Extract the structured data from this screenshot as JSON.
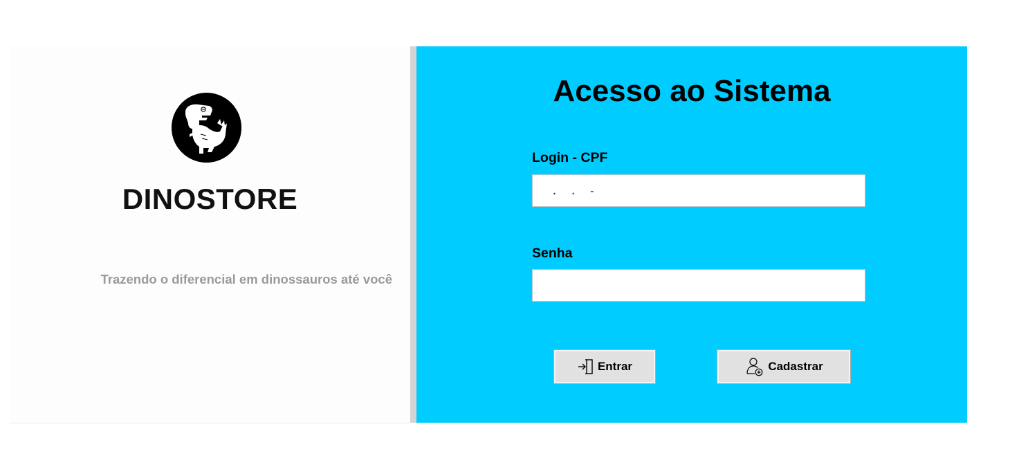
{
  "brand": {
    "name": "DINOSTORE",
    "tagline": "Trazendo o diferencial em dinossauros até você",
    "logo_icon": "dinosaur-icon"
  },
  "login": {
    "title": "Acesso ao Sistema",
    "cpf_label": "Login - CPF",
    "cpf_value": " .  .  -",
    "password_label": "Senha",
    "password_value": "",
    "enter_label": "Entrar",
    "enter_icon": "sign-in-icon",
    "register_label": "Cadastrar",
    "register_icon": "add-user-icon"
  },
  "colors": {
    "panel_background": "#00ccff",
    "button_background": "#e1e1e1"
  }
}
